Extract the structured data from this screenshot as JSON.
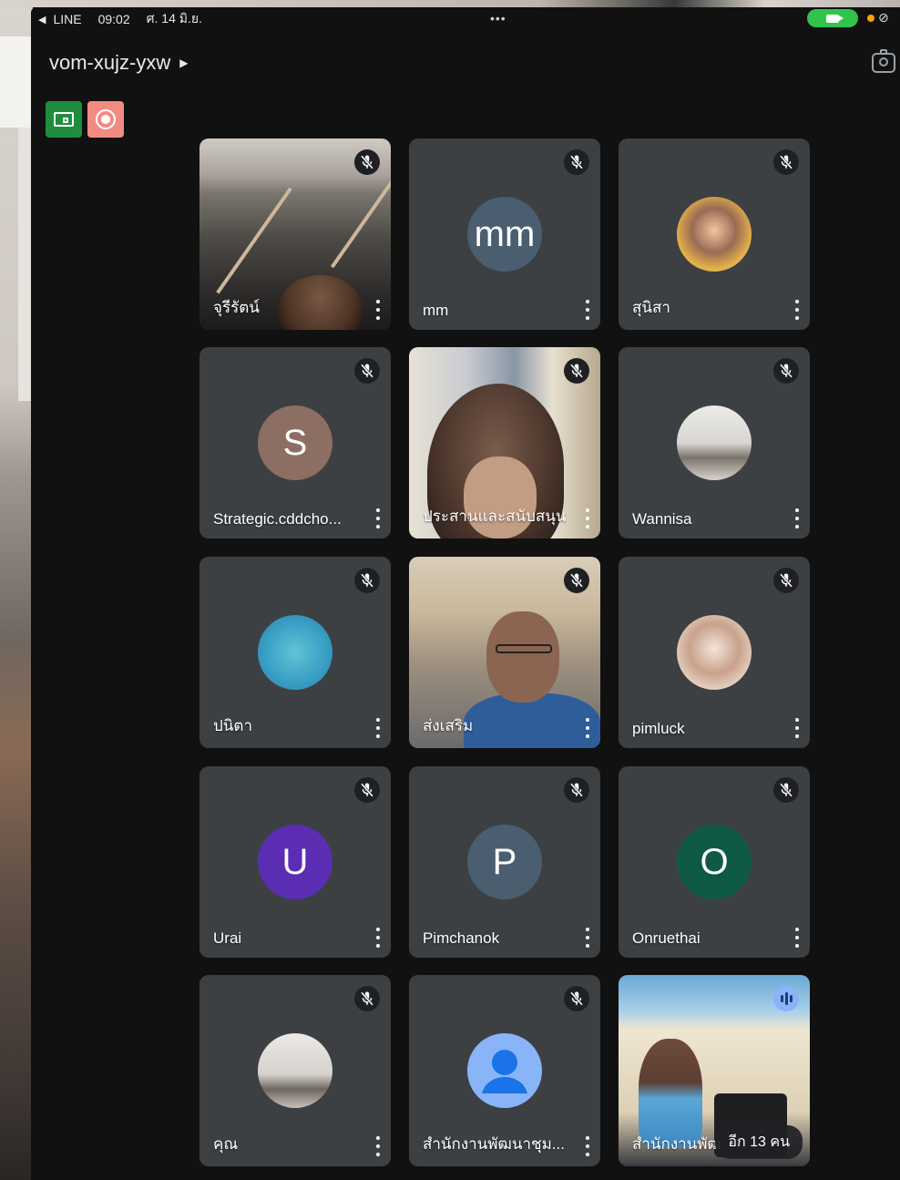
{
  "status_bar": {
    "back_label": "LINE",
    "time": "09:02",
    "date": "ศ. 14 มิ.ย."
  },
  "meeting": {
    "code": "vom-xujz-yxw"
  },
  "tiles": [
    {
      "name": "จุรีรัตน์",
      "type": "video",
      "icon": "mic-off-icon"
    },
    {
      "name": "mm",
      "type": "initial",
      "initial": "mm",
      "avatar_color": "#4a5e70",
      "icon": "mic-off-icon"
    },
    {
      "name": "สุนิสา",
      "type": "photo",
      "icon": "mic-off-icon"
    },
    {
      "name": "Strategic.cddcho...",
      "type": "initial",
      "initial": "S",
      "avatar_color": "#8d6e63",
      "icon": "mic-off-icon"
    },
    {
      "name": "ประสานและสนับสนุน",
      "type": "video",
      "icon": "mic-off-icon"
    },
    {
      "name": "Wannisa",
      "type": "photo",
      "icon": "mic-off-icon"
    },
    {
      "name": "ปนิตา",
      "type": "photo",
      "icon": "mic-off-icon"
    },
    {
      "name": "ส่งเสริม",
      "type": "video",
      "icon": "mic-off-icon"
    },
    {
      "name": "pimluck",
      "type": "photo",
      "icon": "mic-off-icon"
    },
    {
      "name": "Urai",
      "type": "initial",
      "initial": "U",
      "avatar_color": "#5b2db3",
      "icon": "mic-off-icon"
    },
    {
      "name": "Pimchanok",
      "type": "initial",
      "initial": "P",
      "avatar_color": "#4a5e70",
      "icon": "mic-off-icon"
    },
    {
      "name": "Onruethai",
      "type": "initial",
      "initial": "O",
      "avatar_color": "#0f5a45",
      "icon": "mic-off-icon"
    },
    {
      "name": "คุณ",
      "type": "photo",
      "icon": "mic-off-icon"
    },
    {
      "name": "สำนักงานพัฒนาชุม...",
      "type": "default-avatar",
      "avatar_color": "#8ab4f8",
      "icon": "mic-off-icon"
    },
    {
      "name": "สำนักงานพัฒ",
      "type": "video",
      "icon": "speaking-icon",
      "more_label": "อีก 13 คน"
    }
  ],
  "colors": {
    "tile_bg": "#3c4043",
    "screen_bg": "#111112",
    "present_badge": "#1e8e3e",
    "record_badge": "#f28b82"
  }
}
